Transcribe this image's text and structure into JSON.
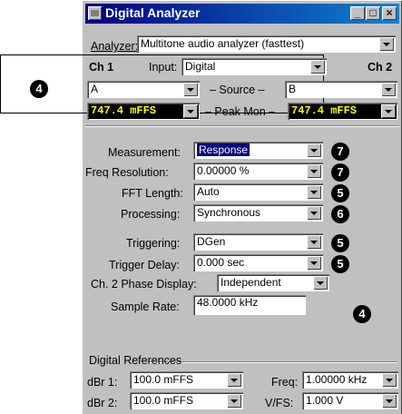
{
  "window": {
    "title": "Digital Analyzer",
    "minimize": "_",
    "maximize": "□",
    "close": "×"
  },
  "analyzer": {
    "label": "Analyzer:",
    "value": "Multitone audio analyzer (fasttest)"
  },
  "channels": {
    "ch1": "Ch 1",
    "ch2": "Ch 2",
    "input_label": "Input:",
    "input_value": "Digital",
    "source_label": "– Source –",
    "source_a": "A",
    "source_b": "B",
    "peakmon_label": "– Peak Mon –",
    "peak_ch1": "747.4  mFFS",
    "peak_ch2": "747.4  mFFS"
  },
  "settings": {
    "measurement": {
      "label": "Measurement:",
      "value": "Response",
      "badge": "7"
    },
    "freq_resolution": {
      "label": "Freq Resolution:",
      "value": "0.00000  %",
      "badge": "7"
    },
    "fft_length": {
      "label": "FFT Length:",
      "value": "Auto",
      "badge": "5"
    },
    "processing": {
      "label": "Processing:",
      "value": "Synchronous",
      "badge": "6"
    },
    "triggering": {
      "label": "Triggering:",
      "value": "DGen",
      "badge": "5"
    },
    "trigger_delay": {
      "label": "Trigger Delay:",
      "value": "0.000   sec",
      "badge": "5"
    },
    "phase_display": {
      "label": "Ch. 2 Phase Display:",
      "value": "Independent"
    },
    "sample_rate": {
      "label": "Sample Rate:",
      "value": "48.0000 kHz",
      "badge": "4"
    }
  },
  "digital_references": {
    "title": "Digital References",
    "dbr1_label": "dBr 1:",
    "dbr1_value": "100.0   mFFS",
    "dbr2_label": "dBr 2:",
    "dbr2_value": "100.0   mFFS",
    "freq_label": "Freq:",
    "freq_value": "1.00000 kHz",
    "vfs_label": "V/FS:",
    "vfs_value": "1.000   V"
  },
  "callout_badge": "4"
}
